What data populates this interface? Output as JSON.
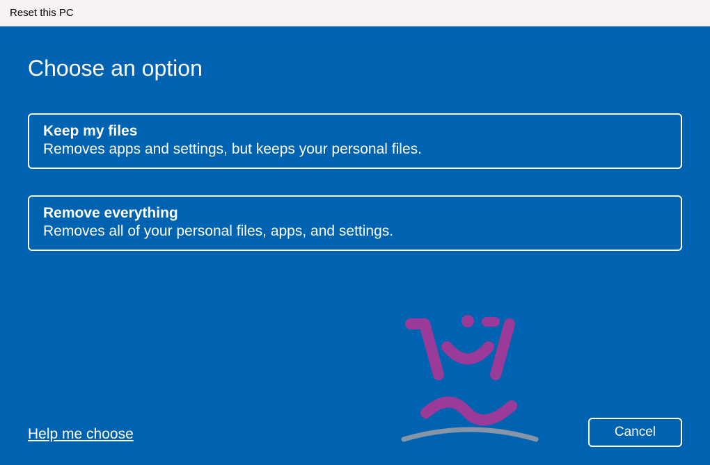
{
  "window": {
    "title": "Reset this PC"
  },
  "page": {
    "heading": "Choose an option"
  },
  "options": [
    {
      "title": "Keep my files",
      "description": "Removes apps and settings, but keeps your personal files."
    },
    {
      "title": "Remove everything",
      "description": "Removes all of your personal files, apps, and settings."
    }
  ],
  "footer": {
    "help_label": "Help me choose",
    "cancel_label": "Cancel"
  }
}
